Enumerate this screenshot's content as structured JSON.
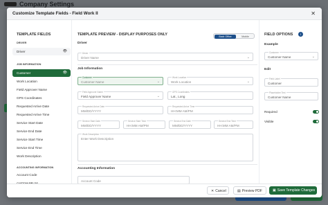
{
  "background": {
    "title": "Company Settings"
  },
  "modal": {
    "title": "Customize Template Fields -  Field Work II",
    "close_icon": "close-icon"
  },
  "left": {
    "title": "TEMPLATE FIELDS",
    "sections": [
      {
        "label": "DRIVER"
      },
      {
        "label": "JOB INFORMATION"
      },
      {
        "label": "ACCOUNTING INFORMATION"
      },
      {
        "label": "CUSTOM FIELDS"
      }
    ],
    "driver_item": "Driver",
    "job_items": [
      "Customer",
      "Work Location",
      "Field Approver Name",
      "GPS Coordinates",
      "Requested Arrive Date",
      "Requested Arrive Time",
      "Service Start Date",
      "Service End Date",
      "Service Start Time",
      "Service End Time",
      "Work Description"
    ],
    "accounting_items": [
      "Account Code"
    ]
  },
  "center": {
    "title": "TEMPLATE PREVIEW - DISPLAY PURPOSES ONLY",
    "toggle": {
      "option_a": "Back Office",
      "option_b": "Mobile",
      "selected": "Back Office"
    },
    "sections": {
      "driver": "Driver",
      "job": "Job Information",
      "accounting": "Accounting Information"
    },
    "fields": {
      "driver": {
        "label": "Driver",
        "placeholder": "Driver Name"
      },
      "customer": {
        "label": "Customer",
        "placeholder": "Customer Name"
      },
      "work_location": {
        "label": "Work Location",
        "placeholder": "Work Location"
      },
      "field_approver": {
        "label": "Field Approver Name",
        "placeholder": "Field Approver Name"
      },
      "gps": {
        "label": "GPS Coordinates",
        "placeholder": "Lat., Long"
      },
      "arrive_date": {
        "label": "Requested Arrive Date",
        "placeholder": "MM/DD/YYYY"
      },
      "arrive_time": {
        "label": "Requested Arrive Time",
        "placeholder": "HH:MM AM/PM"
      },
      "start_date": {
        "label": "Service Start Date",
        "placeholder": "MM/DD/YYYY"
      },
      "start_time": {
        "label": "Service Start Time",
        "placeholder": "HH:MM AM/PM"
      },
      "end_date": {
        "label": "Service End Date",
        "placeholder": "MM/DD/YYYY"
      },
      "end_time": {
        "label": "Service End Time",
        "placeholder": "HH:MM AM/PM"
      },
      "work_desc": {
        "label": "Work Description",
        "placeholder": "Enter Work Description"
      },
      "account_code": {
        "placeholder": "Account Code"
      }
    }
  },
  "right": {
    "title": "FIELD OPTIONS",
    "example_label": "Example",
    "example_field": {
      "label": "Customer",
      "value": "Customer Name"
    },
    "edit_label": "Edit",
    "field_label": {
      "label": "Field Label",
      "value": "Customer"
    },
    "placeholder_text": {
      "label": "Placeholder Text",
      "value": "Customer Name"
    },
    "required_label": "Required",
    "required": true,
    "visible_label": "Visible",
    "visible": true
  },
  "footer": {
    "cancel": "Cancel",
    "preview": "Preview PDF",
    "save": "Save Template Changes"
  },
  "colors": {
    "green": "#1f6b3a",
    "blue": "#1d4f8a"
  }
}
